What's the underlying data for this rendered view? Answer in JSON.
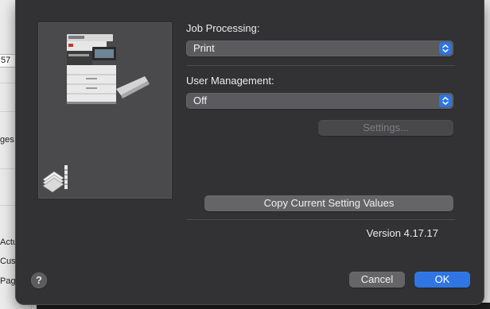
{
  "background_window": {
    "field_text": "57",
    "side_texts": [
      "ges",
      "Actu",
      "Cust",
      "Page"
    ]
  },
  "dialog": {
    "job_processing": {
      "label": "Job Processing:",
      "value": "Print"
    },
    "user_management": {
      "label": "User Management:",
      "value": "Off"
    },
    "settings_button": "Settings...",
    "copy_button": "Copy Current Setting Values",
    "version": "Version 4.17.17",
    "help_button": "?",
    "cancel_button": "Cancel",
    "ok_button": "OK"
  },
  "icons": {
    "popup_chevron": "chevron-up-down-icon",
    "printer": "printer-icon",
    "document_stack": "document-stack-icon",
    "help": "help-icon"
  },
  "colors": {
    "sheet_bg": "#323234",
    "accent": "#2f76e3",
    "popup_bg": "#5b5b5e"
  }
}
